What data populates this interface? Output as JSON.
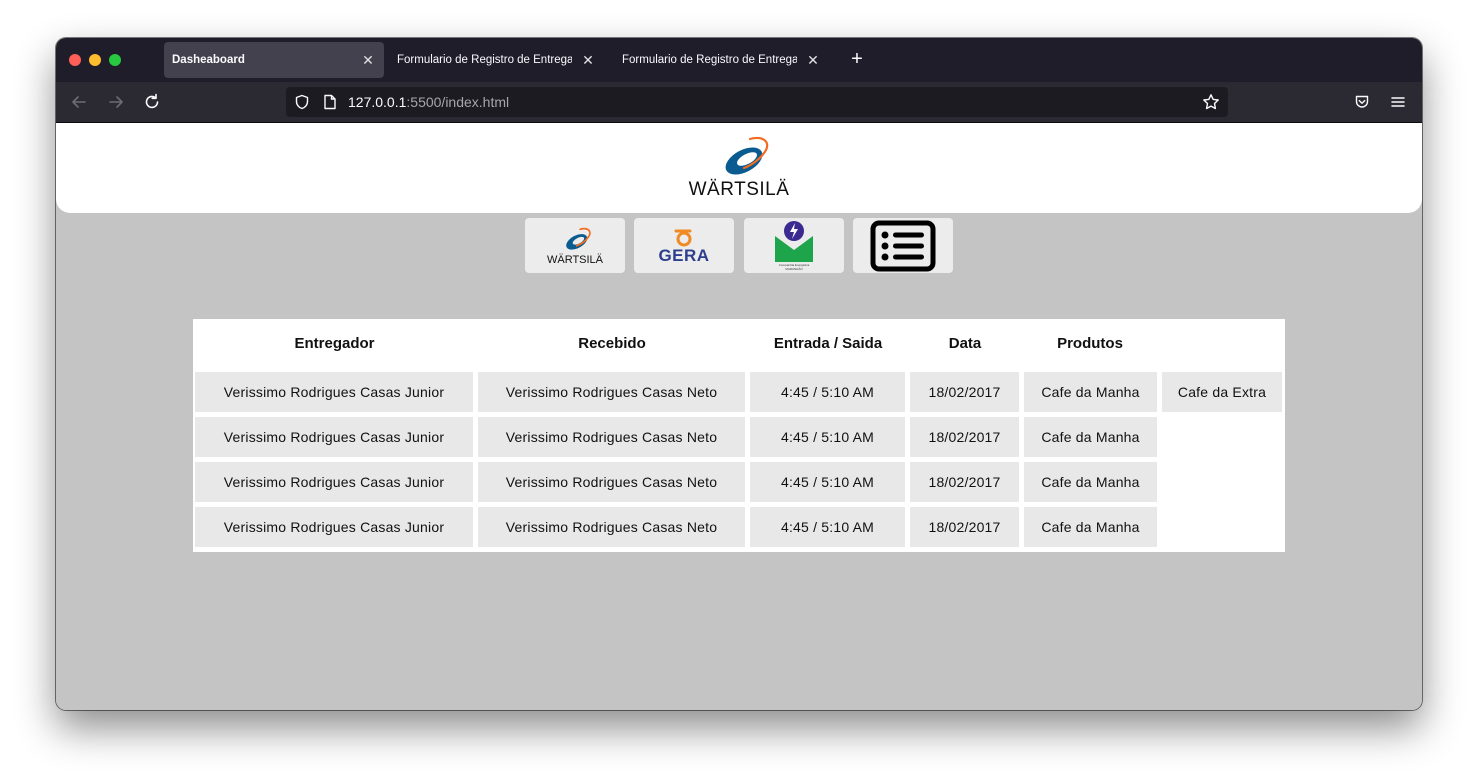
{
  "browser": {
    "tabs": [
      {
        "label": "Dasheaboard",
        "active": true
      },
      {
        "label": "Formulario de Registro de Entrega",
        "active": false
      },
      {
        "label": "Formulario de Registro de Entrega",
        "active": false
      }
    ],
    "new_tab_label": "+",
    "url_host": "127.0.0.1",
    "url_rest": ":5500/index.html",
    "traffic_lights": [
      "#ff5f57",
      "#febc2e",
      "#28c840"
    ]
  },
  "header": {
    "logo_text": "WÄRTSILÄ",
    "brand_colors": {
      "blue": "#0a5b8f",
      "orange": "#f26b21"
    }
  },
  "nav_buttons": [
    {
      "name": "wartsila-button",
      "label": "WÄRTSILÄ"
    },
    {
      "name": "gera-button",
      "label": "GERA"
    },
    {
      "name": "maranhao-button",
      "label": "Companhia Energética MARANHÃO"
    },
    {
      "name": "list-button",
      "icon": "list-icon"
    }
  ],
  "table": {
    "headers": [
      "Entregador",
      "Recebido",
      "Entrada / Saida",
      "Data",
      "Produtos"
    ],
    "rows": [
      {
        "entregador": "Verissimo Rodrigues Casas Junior",
        "recebido": "Verissimo Rodrigues Casas Neto",
        "horario": "4:45 / 5:10 AM",
        "data": "18/02/2017",
        "produtos": [
          "Cafe da Manha",
          "Cafe da Extra"
        ]
      },
      {
        "entregador": "Verissimo Rodrigues Casas Junior",
        "recebido": "Verissimo Rodrigues Casas Neto",
        "horario": "4:45 / 5:10 AM",
        "data": "18/02/2017",
        "produtos": [
          "Cafe da Manha"
        ]
      },
      {
        "entregador": "Verissimo Rodrigues Casas Junior",
        "recebido": "Verissimo Rodrigues Casas Neto",
        "horario": "4:45 / 5:10 AM",
        "data": "18/02/2017",
        "produtos": [
          "Cafe da Manha"
        ]
      },
      {
        "entregador": "Verissimo Rodrigues Casas Junior",
        "recebido": "Verissimo Rodrigues Casas Neto",
        "horario": "4:45 / 5:10 AM",
        "data": "18/02/2017",
        "produtos": [
          "Cafe da Manha"
        ]
      }
    ]
  }
}
